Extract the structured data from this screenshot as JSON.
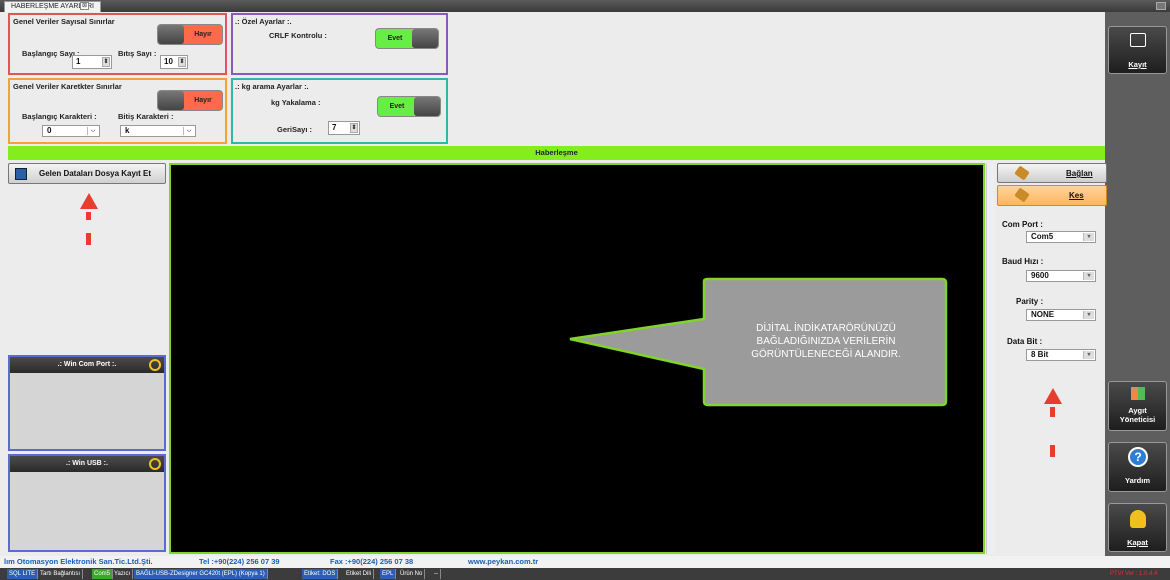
{
  "window": {
    "tab_title": "HABERLEŞME AYARLARI",
    "tab_close": "⊠"
  },
  "numeric_limits": {
    "title": "Genel Veriler Sayısal Sınırlar",
    "toggle": "Hayır",
    "start_label": "Başlangıç Sayı :",
    "start_value": "1",
    "end_label": "Bıtış Sayı :",
    "end_value": "10"
  },
  "char_limits": {
    "title": "Genel Veriler Karetkter Sınırlar",
    "toggle": "Hayır",
    "start_label": "Başlangıç Karakteri :",
    "start_value": "0",
    "end_label": "Bitiş Karakteri :",
    "end_value": "k"
  },
  "special": {
    "title": ".: Özel Ayarlar :.",
    "crlf_label": "CRLF Kontrolu :",
    "crlf_toggle": "Evet"
  },
  "kg": {
    "title": ".: kg arama Ayarlar :.",
    "capture_label": "kg Yakalama :",
    "capture_toggle": "Evet",
    "countdown_label": "GeriSayı :",
    "countdown_value": "7"
  },
  "comm_bar": "Haberleşme",
  "save_button": "Gelen Dataları Dosya Kayıt Et",
  "win_com_port": ".: Win Com Port :.",
  "win_usb": ".: Win USB :.",
  "callout": "DİJİTAL İNDİKATARÖRÜNÜZÜ BAĞLADIĞINIZDA VERİLERİN GÖRÜNTÜLENECEĞİ ALANDIR.",
  "connect": {
    "connect_label": "Bağlan",
    "disconnect_label": "Kes"
  },
  "settings": {
    "com_port_label": "Com Port :",
    "com_port_value": "Com5",
    "baud_label": "Baud Hızı :",
    "baud_value": "9600",
    "parity_label": "Parity :",
    "parity_value": "NONE",
    "databit_label": "Data Bit :",
    "databit_value": "8 Bit"
  },
  "sidebar": {
    "save": "Kayıt",
    "device_manager_1": "Aygıt",
    "device_manager_2": "Yöneticisi",
    "help": "Yardım",
    "close": "Kapat"
  },
  "footer": {
    "company": "lım Otomasyon Elektronik San.Tic.Ltd.Şti.",
    "tel": "Tel :+90(224) 256 07 39",
    "fax": "Fax :+90(224) 256 07 38",
    "web": "www.peykan.com.tr"
  },
  "status": {
    "items": [
      "SQL LITE",
      "Tartı Bağlantısı",
      "Com5",
      "Yazıcı",
      "BAĞLI-USB-ZDesigner GC420t (EPL) (Kopya 1)",
      "Etiket: DOS",
      "Etiket Dili",
      "EPL",
      "Ürün No",
      "--"
    ],
    "version": "PTVI Ver : 1.0.4.4"
  },
  "colors": {
    "accent_green": "#84ee1d",
    "toggle_no": "#ff6a4a",
    "toggle_yes": "#66ee44",
    "arrow_red": "#e63d2e"
  }
}
